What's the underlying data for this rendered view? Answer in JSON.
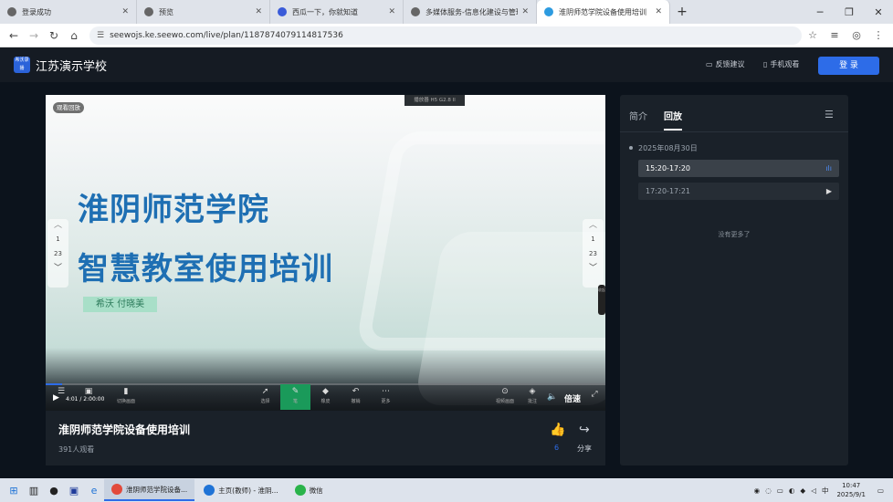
{
  "browser": {
    "tabs": [
      {
        "label": "登录成功",
        "active": false
      },
      {
        "label": "预览",
        "active": false
      },
      {
        "label": "西瓜一下，你就知道",
        "active": false
      },
      {
        "label": "多媒体服务-信息化建设与管理",
        "active": false
      },
      {
        "label": "淮阴师范学院设备使用培训",
        "active": true
      }
    ],
    "new_tab": "+",
    "url": "seewojs.ke.seewo.com/live/plan/1187874079114817536"
  },
  "header": {
    "logo_text": "希沃录播",
    "school": "江苏演示学校",
    "feedback": "反馈建议",
    "mobile": "手机观看",
    "login": "登 录"
  },
  "player": {
    "replay_tag": "观看回放",
    "sticker": "播放器 H5 G2.8 Il",
    "slide_title1": "淮阴师范学院",
    "slide_title2": "智慧教室使用培训",
    "presenter": "希沃 付晓美",
    "page_current": "1",
    "page_total": "23",
    "time": "4:01 / 2:00:00",
    "progress": 0.03,
    "controls_left": [
      {
        "icon": "list-icon",
        "label": ""
      },
      {
        "icon": "screen-icon",
        "label": ""
      },
      {
        "icon": "camera-icon",
        "label": "切换画面"
      }
    ],
    "controls_mid": [
      {
        "icon": "cursor-icon",
        "label": "选择"
      },
      {
        "icon": "pen-icon",
        "label": "笔"
      },
      {
        "icon": "eraser-icon",
        "label": "橡皮"
      },
      {
        "icon": "undo-icon",
        "label": "撤销"
      },
      {
        "icon": "more-icon",
        "label": "更多"
      }
    ],
    "controls_right": [
      {
        "icon": "locate-icon",
        "label": "视频画面"
      },
      {
        "icon": "layers-icon",
        "label": "批注"
      }
    ],
    "speed": "倍速",
    "side_handle": "收起"
  },
  "video_info": {
    "title": "淮阴师范学院设备使用培训",
    "viewers": "391人观看",
    "likes": "6",
    "share": "分享"
  },
  "panel": {
    "tab_intro": "简介",
    "tab_replay": "回放",
    "date": "2025年08月30日",
    "sessions": [
      {
        "time": "15:20-17:20",
        "playing": true
      },
      {
        "time": "17:20-17:21",
        "playing": false
      }
    ],
    "no_more": "没有更多了"
  },
  "taskbar": {
    "apps": [
      {
        "label": "淮阴师范学院设备...",
        "active": true,
        "color": "#e24a3b"
      },
      {
        "label": "主页(教师) - 淮阴...",
        "active": false,
        "color": "#1f73d6"
      },
      {
        "label": "微信",
        "active": false,
        "color": "#29b34a"
      }
    ],
    "ime": "中",
    "time": "10:47",
    "date": "2025/9/1"
  },
  "colors": {
    "accent": "#2d6ce8",
    "slide_title": "#1e6fb3",
    "pen_active": "#1a9a5a"
  }
}
